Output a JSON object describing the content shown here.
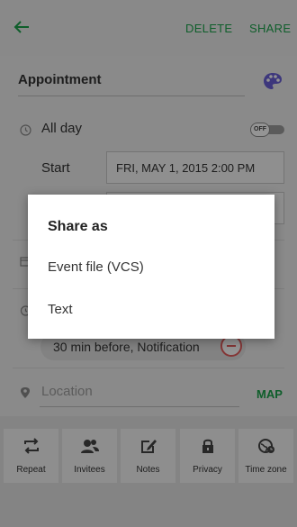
{
  "toolbar": {
    "delete_label": "DELETE",
    "share_label": "SHARE",
    "accent_color": "#1aa34a"
  },
  "event": {
    "title": "Appointment",
    "all_day_label": "All day",
    "all_day_toggle": "OFF",
    "start_label": "Start",
    "start_value": "FRI, MAY 1, 2015   2:00 PM",
    "reminder": "30 min before, Notification",
    "location_placeholder": "Location",
    "map_label": "MAP"
  },
  "bottom_bar": {
    "items": [
      {
        "label": "Repeat",
        "icon": "repeat-icon"
      },
      {
        "label": "Invitees",
        "icon": "invitees-icon"
      },
      {
        "label": "Notes",
        "icon": "notes-icon"
      },
      {
        "label": "Privacy",
        "icon": "lock-icon"
      },
      {
        "label": "Time zone",
        "icon": "time-zone-icon"
      }
    ]
  },
  "dialog": {
    "title": "Share as",
    "options": [
      {
        "label": "Event file (VCS)"
      },
      {
        "label": "Text"
      }
    ]
  }
}
